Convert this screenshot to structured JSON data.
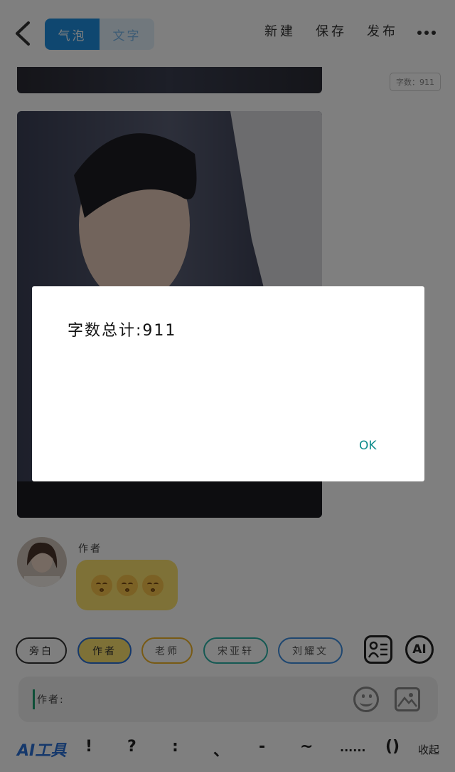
{
  "header": {
    "tabs": [
      "气泡",
      "文字"
    ],
    "actions": [
      "新建",
      "保存",
      "发布"
    ]
  },
  "word_count_badge": "字数：911",
  "author": {
    "name": "作者"
  },
  "roles": [
    "旁白",
    "作者",
    "老师",
    "宋亚轩",
    "刘耀文"
  ],
  "input": {
    "prefix": "作者:"
  },
  "toolbar": {
    "ai_tool": "AI工具",
    "symbols": [
      "!",
      "?",
      ":",
      "、",
      "-",
      "~",
      "......",
      "()",
      "收起"
    ]
  },
  "dialog": {
    "message": "字数总计:911",
    "ok": "OK"
  },
  "colors": {
    "accent": "#1e8fe0",
    "bubble": "#fce26e",
    "ok": "#0d8b8b"
  }
}
